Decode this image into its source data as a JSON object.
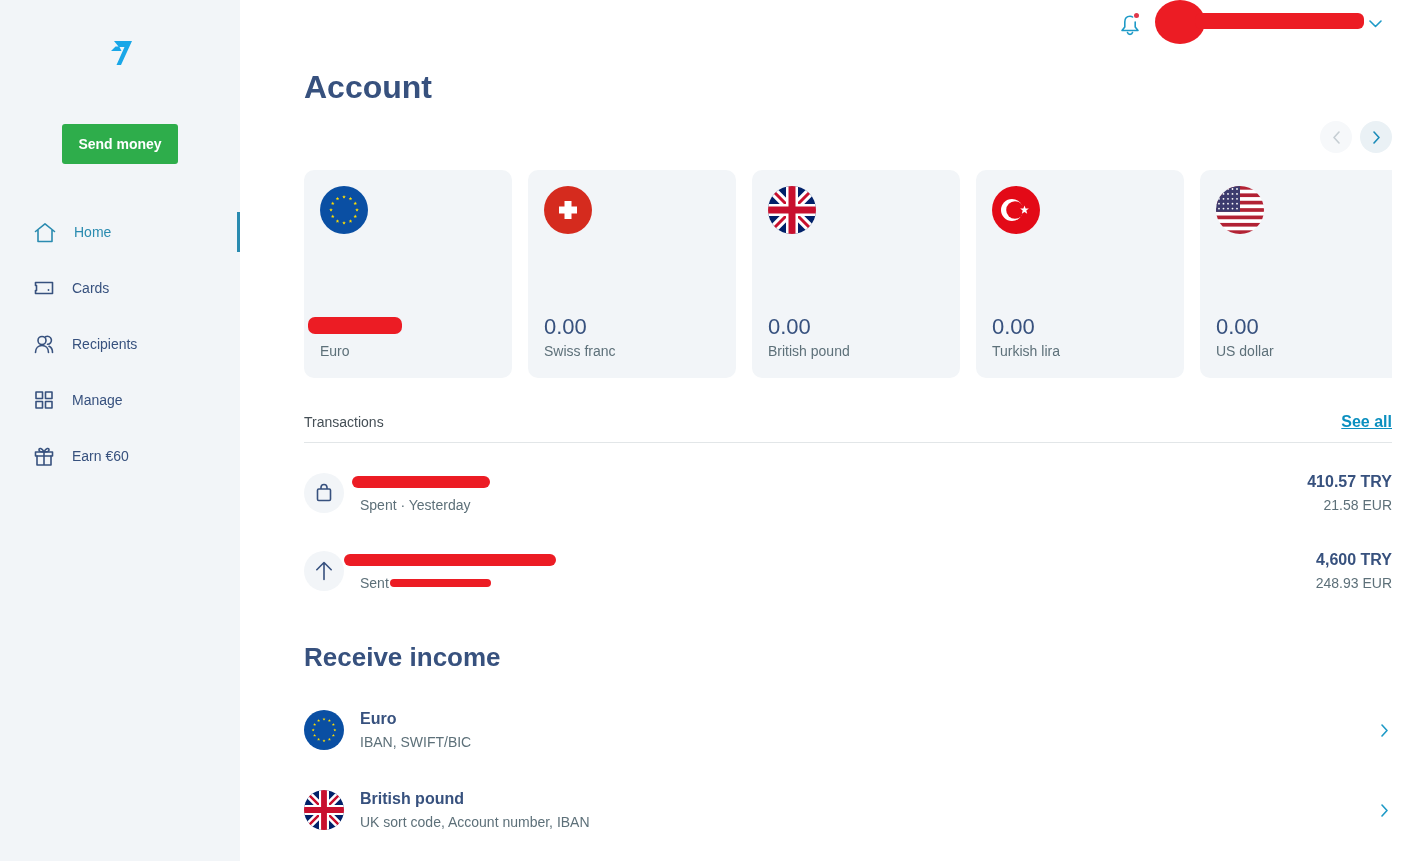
{
  "sidebar": {
    "send_button": "Send money",
    "items": [
      {
        "label": "Home",
        "kind": "home",
        "selected": true
      },
      {
        "label": "Cards",
        "kind": "card",
        "selected": false
      },
      {
        "label": "Recipients",
        "kind": "recipients",
        "selected": false
      },
      {
        "label": "Manage",
        "kind": "grid",
        "selected": false
      },
      {
        "label": "Earn €60",
        "kind": "gift",
        "selected": false
      }
    ]
  },
  "header": {
    "notifications": {
      "unread": true
    },
    "profile": {
      "redacted": true
    }
  },
  "title": "Account",
  "carousel": {
    "prev_disabled": true,
    "next_disabled": false
  },
  "accounts": [
    {
      "kind": "eu",
      "balance_redacted": true,
      "currency": "Euro"
    },
    {
      "kind": "ch",
      "balance": "0.00",
      "currency": "Swiss franc"
    },
    {
      "kind": "gb",
      "balance": "0.00",
      "currency": "British pound"
    },
    {
      "kind": "tr",
      "balance": "0.00",
      "currency": "Turkish lira"
    },
    {
      "kind": "us",
      "balance": "0.00",
      "currency": "US dollar"
    }
  ],
  "transactions": {
    "title": "Transactions",
    "see_all": "See all",
    "items": [
      {
        "kind": "purchase",
        "title_redacted": true,
        "detail": "Spent · Yesterday",
        "amount": "410.57 TRY",
        "converted": "21.58 EUR"
      },
      {
        "kind": "transfer",
        "title_redacted": true,
        "detail": "Sent",
        "detail_redacted": true,
        "amount": "4,600 TRY",
        "converted": "248.93 EUR"
      }
    ]
  },
  "receive_income": {
    "title": "Receive income",
    "items": [
      {
        "kind": "eu",
        "title": "Euro",
        "detail": "IBAN, SWIFT/BIC"
      },
      {
        "kind": "gb",
        "title": "British pound",
        "detail": "UK sort code, Account number, IBAN"
      }
    ]
  }
}
